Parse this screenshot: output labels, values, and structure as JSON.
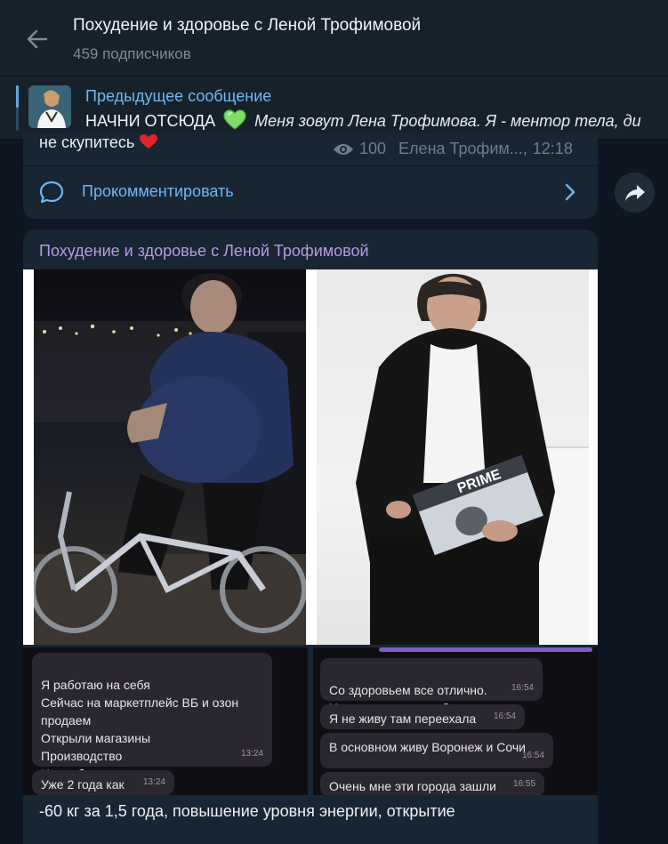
{
  "header": {
    "title": "Похудение и здоровье с Леной Трофимовой",
    "subtitle": "459 подписчиков"
  },
  "pinned": {
    "title": "Предыдущее сообщение",
    "text_bold": "НАЧНИ ОТСЮДА",
    "text_italic": "Меня зовут Лена Трофимова. Я - ментор тела, ди"
  },
  "prev_message": {
    "text": "не скупитесь",
    "views": "100",
    "author": "Елена Трофим...,",
    "time": "12:18",
    "comment_label": "Прокомментировать"
  },
  "post": {
    "author": "Похудение и здоровье с Леной Трофимовой",
    "magazine_label": "PRIME",
    "caption": "-60 кг за 1,5 года, повышение уровня энергии, открытие",
    "chat_left": [
      {
        "text": "Я работаю на себя\nСейчас на маркетплейс ВБ и озон продаем\nОткрыли магазины\nПроизводство\nНиша бытовая химия",
        "time": "13:24"
      },
      {
        "text": "Уже 2 года как",
        "time": "13:24"
      }
    ],
    "chat_right": [
      {
        "text": "Со здоровьем все отлично.\nУмничка рада за тебя очень",
        "time": "16:54"
      },
      {
        "text": "Я не живу там переехала",
        "time": "16:54"
      },
      {
        "text": "В основном живу Воронеж и Сочи",
        "time": "16:54"
      },
      {
        "text": "Очень мне эти города зашли",
        "time": "16:55"
      }
    ]
  },
  "colors": {
    "background": "#0e1621",
    "header": "#17212b",
    "bubble": "#182533",
    "link": "#71b8f2",
    "author": "#b69be0"
  },
  "icons": [
    "back-arrow-icon",
    "green-heart-icon",
    "red-heart-icon",
    "eye-icon",
    "comment-icon",
    "chevron-right-icon",
    "forward-icon"
  ]
}
